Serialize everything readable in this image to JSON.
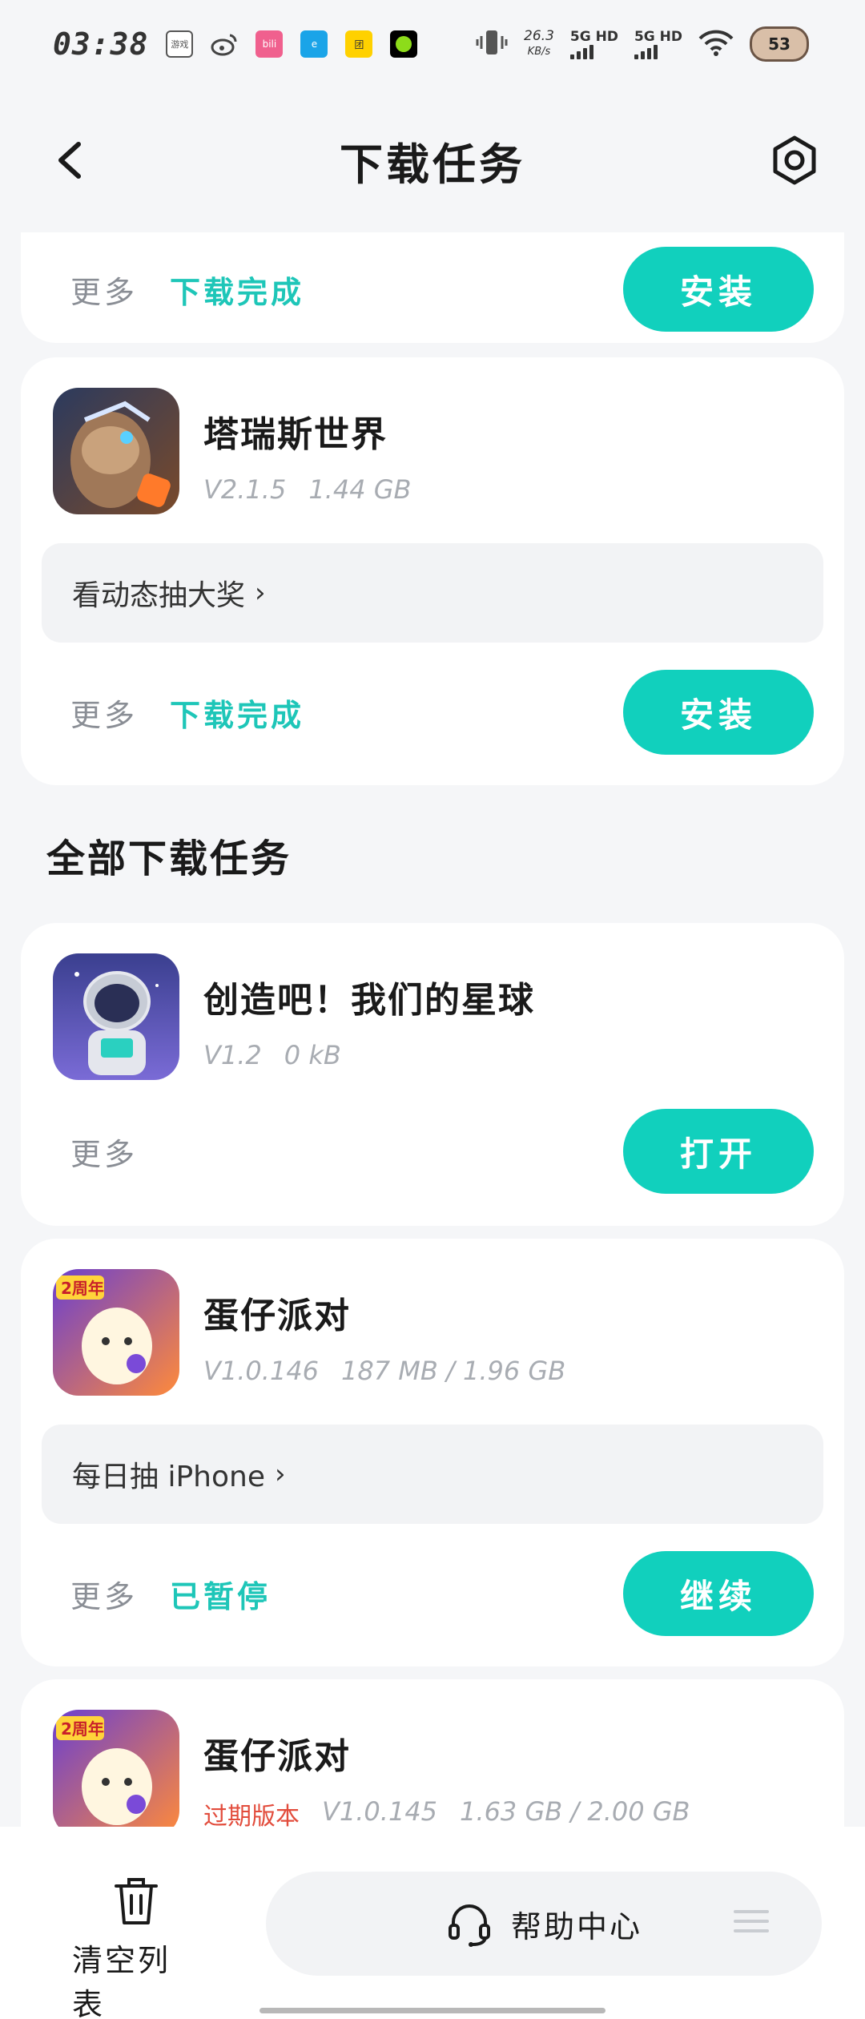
{
  "status_bar": {
    "time": "03:38",
    "apps": [
      "游戏大全",
      "微博",
      "bilibili",
      "饿了么",
      "美团",
      "小绿"
    ],
    "net_speed": "26.3",
    "net_unit": "KB/s",
    "signal1": "5G HD",
    "signal2": "5G HD",
    "battery": "53"
  },
  "header": {
    "title": "下载任务"
  },
  "partial_card": {
    "more": "更多",
    "status": "下载完成",
    "button": "安装"
  },
  "card1": {
    "name": "塔瑞斯世界",
    "version": "V2.1.5",
    "size": "1.44 GB",
    "promo": "看动态抽大奖",
    "more": "更多",
    "status": "下载完成",
    "button": "安装"
  },
  "section_title": "全部下载任务",
  "card2": {
    "name": "创造吧！我们的星球",
    "version": "V1.2",
    "size": "0 kB",
    "more": "更多",
    "button": "打开"
  },
  "card3": {
    "name": "蛋仔派对",
    "version": "V1.0.146",
    "size": "187 MB / 1.96 GB",
    "promo": "每日抽 iPhone",
    "more": "更多",
    "status": "已暂停",
    "button": "继续"
  },
  "card4": {
    "name": "蛋仔派对",
    "expired": "过期版本",
    "version": "V1.0.145",
    "size": "1.63 GB / 2.00 GB"
  },
  "bottom": {
    "clear_label": "清空列表",
    "help_label": "帮助中心"
  },
  "colors": {
    "accent": "#11d0bd",
    "status_text": "#1ec6b8",
    "expired": "#e24c3c"
  }
}
